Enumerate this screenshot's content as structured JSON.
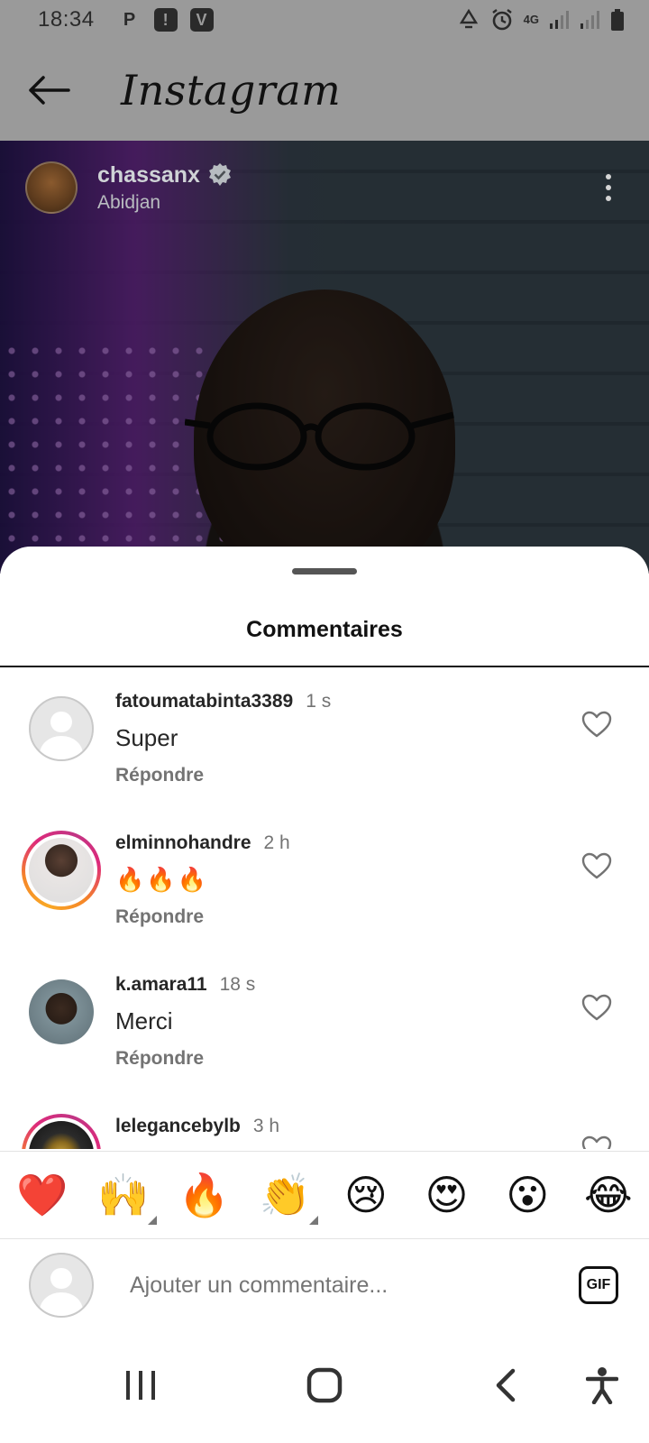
{
  "status_bar": {
    "time": "18:34",
    "left_icons": [
      "p-icon",
      "alert-icon",
      "v-icon"
    ],
    "right_icons": [
      "recycle-icon",
      "alarm-icon",
      "4g-icon",
      "signal-icon",
      "signal-icon",
      "battery-icon"
    ],
    "network": "4G"
  },
  "app": {
    "title": "Instagram"
  },
  "post": {
    "username": "chassanx",
    "verified": true,
    "location": "Abidjan"
  },
  "sheet": {
    "title": "Commentaires"
  },
  "comments": [
    {
      "username": "fatoumatabinta3389",
      "time": "1 s",
      "text": "Super",
      "reply_label": "Répondre",
      "avatar": "default",
      "story_ring": false
    },
    {
      "username": "elminnohandre",
      "time": "2 h",
      "text": "🔥🔥🔥",
      "reply_label": "Répondre",
      "avatar": "photo",
      "story_ring": true
    },
    {
      "username": "k.amara11",
      "time": "18 s",
      "text": "Merci",
      "reply_label": "Répondre",
      "avatar": "photo",
      "story_ring": false
    },
    {
      "username": "lelegancebylb",
      "time": "3 h",
      "text": "",
      "reply_label": "",
      "avatar": "photo",
      "story_ring": true
    }
  ],
  "emoji_bar": [
    "❤️",
    "🙌",
    "🔥",
    "👏",
    "😢",
    "😍",
    "😮",
    "😂"
  ],
  "composer": {
    "placeholder": "Ajouter un commentaire...",
    "gif_label": "GIF"
  },
  "colors": {
    "header_bg": "#9a9a9a",
    "text_primary": "#262626",
    "text_secondary": "#737373",
    "placeholder": "#a8a8a8"
  }
}
